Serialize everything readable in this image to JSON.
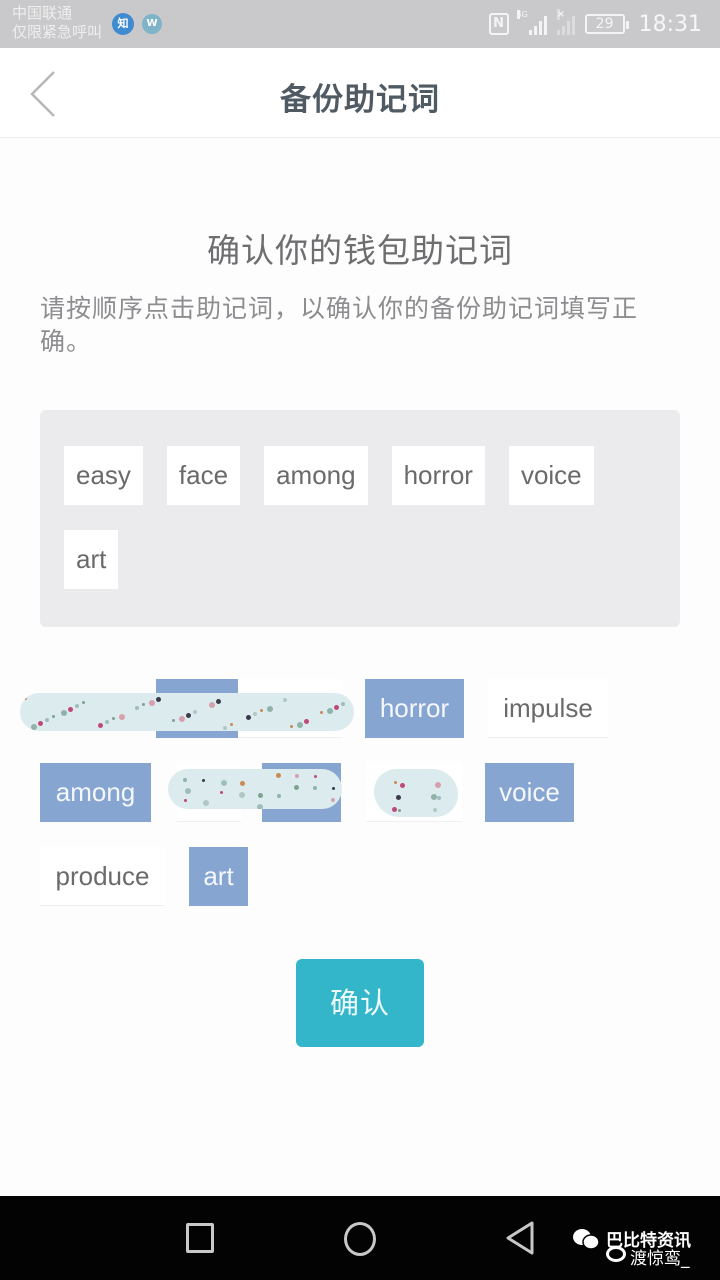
{
  "status_bar": {
    "carrier_line1": "中国联通",
    "carrier_line2": "仅限紧急呼叫",
    "notification_icons": [
      "zhihu-icon",
      "w-app-icon"
    ],
    "zhihu_label": "知",
    "w_label": "W",
    "nfc_label": "N",
    "network_type": "4G",
    "battery_level": "29",
    "time": "18:31"
  },
  "header": {
    "back_icon": "chevron-left-icon",
    "title": "备份助记词"
  },
  "main": {
    "section_title": "确认你的钱包助记词",
    "instructions": "请按顺序点击助记词，以确认你的备份助记词填写正确。",
    "selected_words": [
      "easy",
      "face",
      "among",
      "horror",
      "voice",
      "art"
    ],
    "word_pool": [
      {
        "word": "",
        "state": "used",
        "redacted": true
      },
      {
        "word": "",
        "state": "unused",
        "redacted": true
      },
      {
        "word": "horror",
        "state": "used",
        "redacted": false
      },
      {
        "word": "impulse",
        "state": "unused",
        "redacted": false
      },
      {
        "word": "among",
        "state": "used",
        "redacted": false
      },
      {
        "word": "",
        "state": "unused",
        "redacted": true
      },
      {
        "word": "",
        "state": "used",
        "redacted": true
      },
      {
        "word": "",
        "state": "unused",
        "redacted": true
      },
      {
        "word": "voice",
        "state": "used",
        "redacted": false
      },
      {
        "word": "produce",
        "state": "unused",
        "redacted": false
      },
      {
        "word": "art",
        "state": "used",
        "redacted": false
      }
    ],
    "confirm_label": "确认"
  },
  "colors": {
    "used_chip": "#86a6d1",
    "confirm_button": "#33b6c9",
    "panel_bg": "#ebeaed"
  },
  "nav_bar": {
    "recent_icon": "square-icon",
    "home_icon": "circle-icon",
    "back_icon": "triangle-back-icon"
  },
  "watermark": {
    "line1": "巴比特资讯",
    "line2": "渡惊鸾_"
  }
}
